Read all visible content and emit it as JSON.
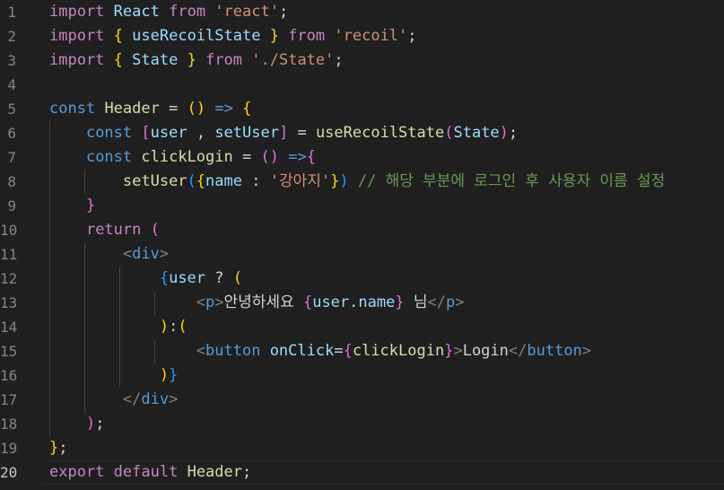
{
  "editor": {
    "current_line": 20,
    "lines": [
      {
        "n": 1,
        "tokens": [
          [
            "import",
            "kw-pink"
          ],
          [
            " ",
            "punc"
          ],
          [
            "React",
            "var"
          ],
          [
            " ",
            "punc"
          ],
          [
            "from",
            "kw-pink"
          ],
          [
            " ",
            "punc"
          ],
          [
            "'react'",
            "str"
          ],
          [
            ";",
            "punc"
          ]
        ]
      },
      {
        "n": 2,
        "tokens": [
          [
            "import",
            "kw-pink"
          ],
          [
            " ",
            "punc"
          ],
          [
            "{",
            "b1"
          ],
          [
            " useRecoilState ",
            "var"
          ],
          [
            "}",
            "b1"
          ],
          [
            " ",
            "punc"
          ],
          [
            "from",
            "kw-pink"
          ],
          [
            " ",
            "punc"
          ],
          [
            "'recoil'",
            "str"
          ],
          [
            ";",
            "punc"
          ]
        ]
      },
      {
        "n": 3,
        "tokens": [
          [
            "import",
            "kw-pink"
          ],
          [
            " ",
            "punc"
          ],
          [
            "{",
            "b1"
          ],
          [
            " State ",
            "var"
          ],
          [
            "}",
            "b1"
          ],
          [
            " ",
            "punc"
          ],
          [
            "from",
            "kw-pink"
          ],
          [
            " ",
            "punc"
          ],
          [
            "'./State'",
            "str"
          ],
          [
            ";",
            "punc"
          ]
        ]
      },
      {
        "n": 4,
        "tokens": []
      },
      {
        "n": 5,
        "tokens": [
          [
            "const",
            "kw-blue"
          ],
          [
            " ",
            "punc"
          ],
          [
            "Header",
            "fn"
          ],
          [
            " = ",
            "punc"
          ],
          [
            "(",
            "b1"
          ],
          [
            ")",
            "b1"
          ],
          [
            " ",
            "punc"
          ],
          [
            "=>",
            "kw-blue"
          ],
          [
            " ",
            "punc"
          ],
          [
            "{",
            "b1"
          ]
        ]
      },
      {
        "n": 6,
        "tokens": [
          [
            "    ",
            "punc"
          ],
          [
            "const",
            "kw-blue"
          ],
          [
            " ",
            "punc"
          ],
          [
            "[",
            "b2"
          ],
          [
            "user",
            "var"
          ],
          [
            " , ",
            "punc"
          ],
          [
            "setUser",
            "var"
          ],
          [
            "]",
            "b2"
          ],
          [
            " = ",
            "punc"
          ],
          [
            "useRecoilState",
            "fn"
          ],
          [
            "(",
            "b2"
          ],
          [
            "State",
            "var"
          ],
          [
            ")",
            "b2"
          ],
          [
            ";",
            "punc"
          ]
        ]
      },
      {
        "n": 7,
        "tokens": [
          [
            "    ",
            "punc"
          ],
          [
            "const",
            "kw-blue"
          ],
          [
            " ",
            "punc"
          ],
          [
            "clickLogin",
            "fn"
          ],
          [
            " = ",
            "punc"
          ],
          [
            "(",
            "b2"
          ],
          [
            ")",
            "b2"
          ],
          [
            " ",
            "punc"
          ],
          [
            "=>",
            "kw-blue"
          ],
          [
            "{",
            "b2"
          ]
        ]
      },
      {
        "n": 8,
        "tokens": [
          [
            "        ",
            "punc"
          ],
          [
            "setUser",
            "fn"
          ],
          [
            "(",
            "b3"
          ],
          [
            "{",
            "b1"
          ],
          [
            "name",
            "var"
          ],
          [
            " : ",
            "punc"
          ],
          [
            "'강아지'",
            "str"
          ],
          [
            "}",
            "b1"
          ],
          [
            ")",
            "b3"
          ],
          [
            " ",
            "punc"
          ],
          [
            "// 해당 부분에 로그인 후 사용자 이름 설정",
            "cmt"
          ]
        ]
      },
      {
        "n": 9,
        "tokens": [
          [
            "    ",
            "punc"
          ],
          [
            "}",
            "b2"
          ]
        ]
      },
      {
        "n": 10,
        "tokens": [
          [
            "    ",
            "punc"
          ],
          [
            "return",
            "kw-pink"
          ],
          [
            " ",
            "punc"
          ],
          [
            "(",
            "b2"
          ]
        ]
      },
      {
        "n": 11,
        "tokens": [
          [
            "        ",
            "punc"
          ],
          [
            "<",
            "tagbr"
          ],
          [
            "div",
            "tag"
          ],
          [
            ">",
            "tagbr"
          ]
        ]
      },
      {
        "n": 12,
        "tokens": [
          [
            "            ",
            "punc"
          ],
          [
            "{",
            "b3"
          ],
          [
            "user",
            "var"
          ],
          [
            " ? ",
            "punc"
          ],
          [
            "(",
            "b1"
          ]
        ]
      },
      {
        "n": 13,
        "tokens": [
          [
            "                ",
            "punc"
          ],
          [
            "<",
            "tagbr"
          ],
          [
            "p",
            "tag"
          ],
          [
            ">",
            "tagbr"
          ],
          [
            "안녕하세요 ",
            "punc"
          ],
          [
            "{",
            "b2"
          ],
          [
            "user",
            "var"
          ],
          [
            ".",
            "punc"
          ],
          [
            "name",
            "var"
          ],
          [
            "}",
            "b2"
          ],
          [
            " 님",
            "punc"
          ],
          [
            "</",
            "tagbr"
          ],
          [
            "p",
            "tag"
          ],
          [
            ">",
            "tagbr"
          ]
        ]
      },
      {
        "n": 14,
        "tokens": [
          [
            "            ",
            "punc"
          ],
          [
            ")",
            "b1"
          ],
          [
            ":",
            "punc"
          ],
          [
            "(",
            "b1"
          ]
        ]
      },
      {
        "n": 15,
        "tokens": [
          [
            "                ",
            "punc"
          ],
          [
            "<",
            "tagbr"
          ],
          [
            "button",
            "tag"
          ],
          [
            " ",
            "punc"
          ],
          [
            "onClick",
            "attr"
          ],
          [
            "=",
            "punc"
          ],
          [
            "{",
            "b2"
          ],
          [
            "clickLogin",
            "fn"
          ],
          [
            "}",
            "b2"
          ],
          [
            ">",
            "tagbr"
          ],
          [
            "Login",
            "punc"
          ],
          [
            "</",
            "tagbr"
          ],
          [
            "button",
            "tag"
          ],
          [
            ">",
            "tagbr"
          ]
        ]
      },
      {
        "n": 16,
        "tokens": [
          [
            "            ",
            "punc"
          ],
          [
            ")",
            "b1"
          ],
          [
            "}",
            "b3"
          ]
        ]
      },
      {
        "n": 17,
        "tokens": [
          [
            "        ",
            "punc"
          ],
          [
            "</",
            "tagbr"
          ],
          [
            "div",
            "tag"
          ],
          [
            ">",
            "tagbr"
          ]
        ]
      },
      {
        "n": 18,
        "tokens": [
          [
            "    ",
            "punc"
          ],
          [
            ")",
            "b2"
          ],
          [
            ";",
            "punc"
          ]
        ]
      },
      {
        "n": 19,
        "tokens": [
          [
            "}",
            "b1"
          ],
          [
            ";",
            "punc"
          ]
        ]
      },
      {
        "n": 20,
        "tokens": [
          [
            "export",
            "kw-pink"
          ],
          [
            " ",
            "punc"
          ],
          [
            "default",
            "kw-pink"
          ],
          [
            " ",
            "punc"
          ],
          [
            "Header",
            "fn"
          ],
          [
            ";",
            "punc"
          ]
        ]
      }
    ]
  }
}
